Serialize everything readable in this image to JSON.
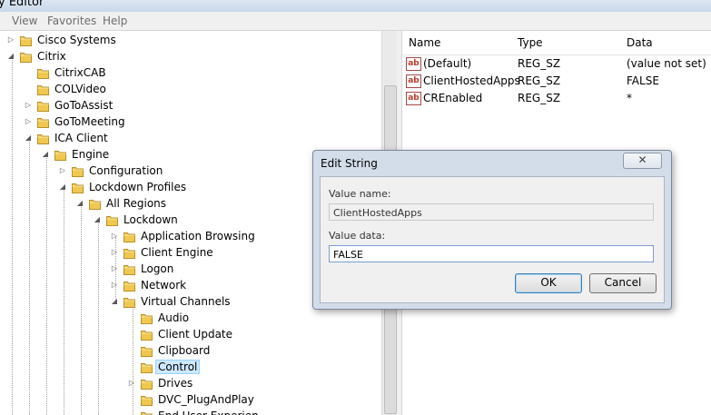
{
  "window": {
    "title": "y Editor"
  },
  "menu": {
    "view": "View",
    "favorites": "Favorites",
    "help": "Help"
  },
  "tree": {
    "items": [
      {
        "label": "Cisco Systems",
        "indent": 0,
        "expander": "closed"
      },
      {
        "label": "Citrix",
        "indent": 0,
        "expander": "open"
      },
      {
        "label": "CitrixCAB",
        "indent": 1,
        "expander": "none"
      },
      {
        "label": "COLVideo",
        "indent": 1,
        "expander": "none"
      },
      {
        "label": "GoToAssist",
        "indent": 1,
        "expander": "closed"
      },
      {
        "label": "GoToMeeting",
        "indent": 1,
        "expander": "closed"
      },
      {
        "label": "ICA Client",
        "indent": 1,
        "expander": "open"
      },
      {
        "label": "Engine",
        "indent": 2,
        "expander": "open"
      },
      {
        "label": "Configuration",
        "indent": 3,
        "expander": "closed"
      },
      {
        "label": "Lockdown Profiles",
        "indent": 3,
        "expander": "open"
      },
      {
        "label": "All Regions",
        "indent": 4,
        "expander": "open"
      },
      {
        "label": "Lockdown",
        "indent": 5,
        "expander": "open"
      },
      {
        "label": "Application Browsing",
        "indent": 6,
        "expander": "closed"
      },
      {
        "label": "Client Engine",
        "indent": 6,
        "expander": "closed"
      },
      {
        "label": "Logon",
        "indent": 6,
        "expander": "closed"
      },
      {
        "label": "Network",
        "indent": 6,
        "expander": "closed"
      },
      {
        "label": "Virtual Channels",
        "indent": 6,
        "expander": "open"
      },
      {
        "label": "Audio",
        "indent": 7,
        "expander": "none"
      },
      {
        "label": "Client Update",
        "indent": 7,
        "expander": "none"
      },
      {
        "label": "Clipboard",
        "indent": 7,
        "expander": "none"
      },
      {
        "label": "Control",
        "indent": 7,
        "expander": "none",
        "selected": true
      },
      {
        "label": "Drives",
        "indent": 7,
        "expander": "closed"
      },
      {
        "label": "DVC_PlugAndPlay",
        "indent": 7,
        "expander": "none"
      },
      {
        "label": "End User Experien",
        "indent": 7,
        "expander": "none"
      }
    ]
  },
  "values": {
    "headers": {
      "name": "Name",
      "type": "Type",
      "data": "Data"
    },
    "rows": [
      {
        "name": "(Default)",
        "type": "REG_SZ",
        "data": "(value not set)"
      },
      {
        "name": "ClientHostedApps",
        "type": "REG_SZ",
        "data": "FALSE"
      },
      {
        "name": "CREnabled",
        "type": "REG_SZ",
        "data": "*"
      }
    ],
    "icon_text": "ab"
  },
  "dialog": {
    "title": "Edit String",
    "close_glyph": "✕",
    "value_name_label": "Value name:",
    "value_name": "ClientHostedApps",
    "value_data_label": "Value data:",
    "value_data": "FALSE",
    "ok_label": "OK",
    "cancel_label": "Cancel"
  },
  "colors": {
    "selection": "#cde8ff",
    "folder": "#f0c850",
    "dialog_frame": "#d3ddea"
  }
}
